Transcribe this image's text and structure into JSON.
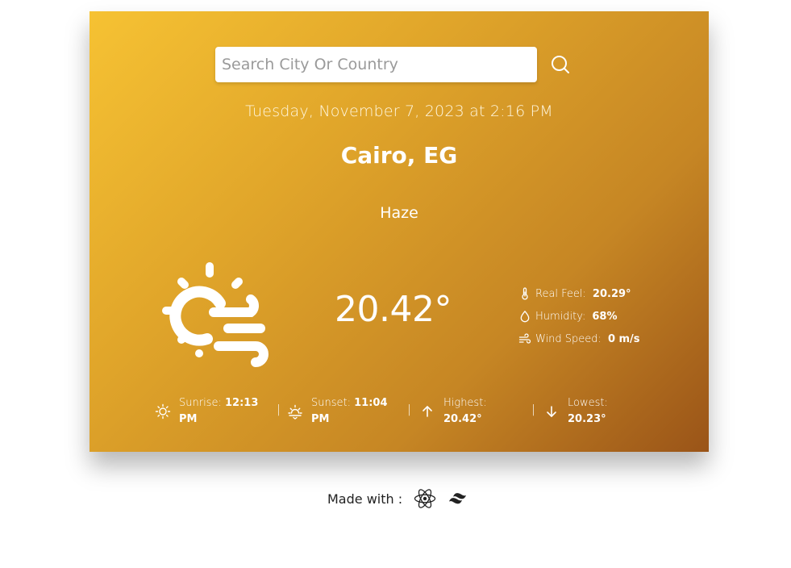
{
  "search": {
    "placeholder": "Search City Or Country",
    "value": ""
  },
  "datetime": "Tuesday, November 7, 2023 at 2:16 PM",
  "location": "Cairo, EG",
  "condition": "Haze",
  "weather_icon": "haze-sun-icon",
  "temperature": "20.42°",
  "details": [
    {
      "icon": "thermometer-icon",
      "label": "Real Feel:",
      "value": "20.29°"
    },
    {
      "icon": "droplet-icon",
      "label": "Humidity:",
      "value": "68%"
    },
    {
      "icon": "wind-icon",
      "label": "Wind Speed:",
      "value": "0 m/s"
    }
  ],
  "bottom": {
    "sunrise": {
      "label": "Sunrise:",
      "value_line1": "12:13",
      "value_line2": "PM",
      "icon": "sun-icon"
    },
    "sunset": {
      "label": "Sunset:",
      "value_line1": "11:04",
      "value_line2": "PM",
      "icon": "sunset-icon"
    },
    "highest": {
      "label": "Highest:",
      "value": "20.42°",
      "icon": "arrow-up-icon"
    },
    "lowest": {
      "label": "Lowest:",
      "value": "20.23°",
      "icon": "arrow-down-icon"
    },
    "separator": "|"
  },
  "footer": {
    "text": "Made with :",
    "icons": [
      "react-icon",
      "tailwind-icon"
    ]
  },
  "colors": {
    "gradient_start": "#f6c233",
    "gradient_end": "#9a5418",
    "text": "#ffffff"
  }
}
